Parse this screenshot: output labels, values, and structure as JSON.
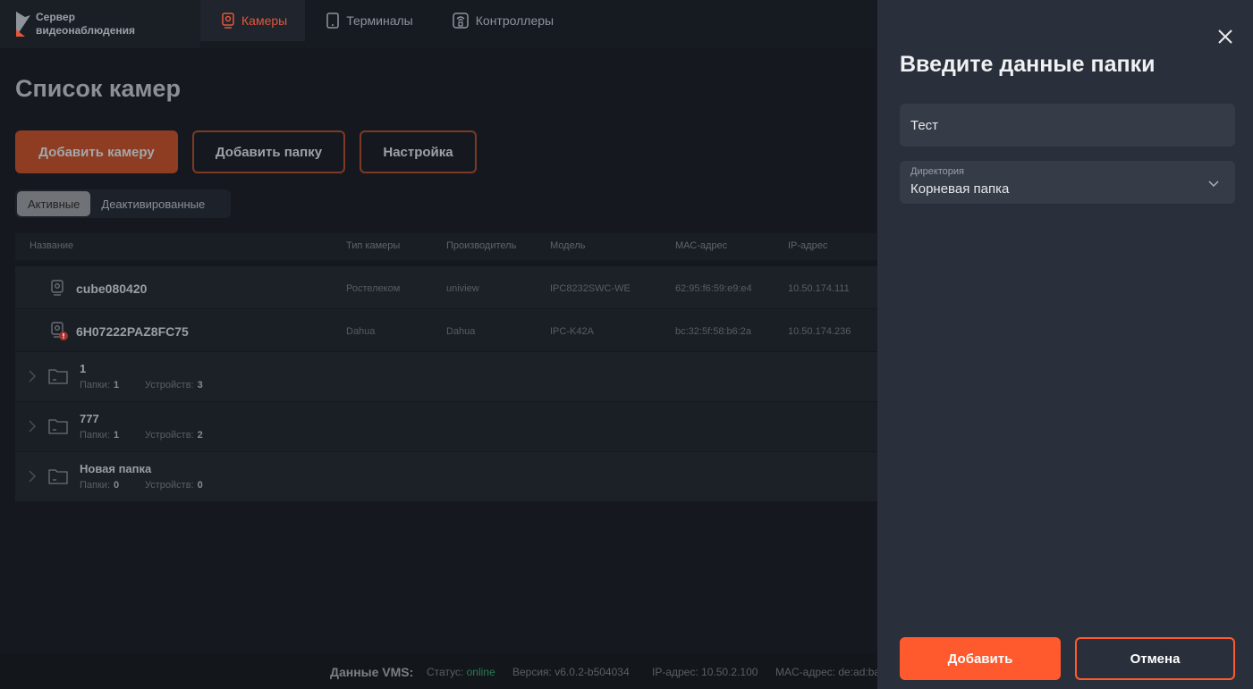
{
  "header": {
    "logo_line1": "Сервер",
    "logo_line2": "видеонаблюдения",
    "nav": [
      {
        "label": "Камеры",
        "icon": "camera-icon",
        "active": true
      },
      {
        "label": "Терминалы",
        "icon": "tablet-icon"
      },
      {
        "label": "Контроллеры",
        "icon": "controller-icon"
      }
    ]
  },
  "main": {
    "title": "Список камер",
    "buttons": {
      "add_camera": "Добавить камеру",
      "add_folder": "Добавить папку",
      "settings": "Настройка"
    },
    "tabs": [
      "Активные",
      "Деактивированные"
    ],
    "columns": [
      "Название",
      "Тип камеры",
      "Производитель",
      "Модель",
      "МАС-адрес",
      "IP-адрес"
    ],
    "cameras": [
      {
        "name": "cube080420",
        "type": "Ростелеком",
        "vendor": "uniview",
        "model": "IPC8232SWC-WE",
        "mac": "62:95:f6:59:e9:e4",
        "ip": "10.50.174.111",
        "warning": false
      },
      {
        "name": "6H07222PAZ8FC75",
        "type": "Dahua",
        "vendor": "Dahua",
        "model": "IPC-K42A",
        "mac": "bc:32:5f:58:b6:2a",
        "ip": "10.50.174.236",
        "warning": true
      }
    ],
    "folders": [
      {
        "name": "1",
        "folders_label": "Папки:",
        "folders": "1",
        "devices_label": "Устройств:",
        "devices": "3"
      },
      {
        "name": "777",
        "folders_label": "Папки:",
        "folders": "1",
        "devices_label": "Устройств:",
        "devices": "2"
      },
      {
        "name": "Новая папка",
        "folders_label": "Папки:",
        "folders": "0",
        "devices_label": "Устройств:",
        "devices": "0"
      }
    ]
  },
  "statusbar": {
    "title": "Данные VMS:",
    "status_label": "Статус:",
    "status_value": "online",
    "version": "Версия: v6.0.2-b504034",
    "ip": "IP-адрес: 10.50.2.100",
    "mac": "MAC-адрес: de:ad:ba"
  },
  "panel": {
    "title": "Введите данные папки",
    "name_value": "Тест",
    "dir_label": "Директория",
    "dir_value": "Корневая папка",
    "add": "Добавить",
    "cancel": "Отмена"
  },
  "colors": {
    "accent": "#ff5a2d",
    "online": "#2fa36b",
    "warning": "#d63a2f"
  }
}
